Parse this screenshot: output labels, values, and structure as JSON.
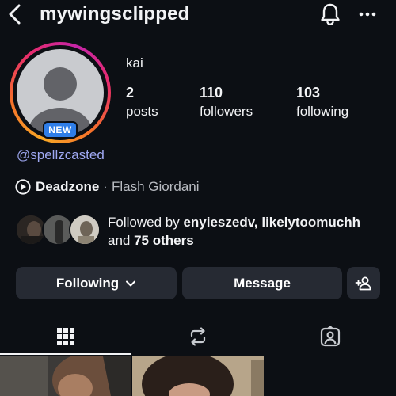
{
  "header": {
    "username": "mywingsclipped",
    "icons": {
      "back": "chevron-left-icon",
      "notifications": "bell-icon",
      "more": "more-horizontal-icon"
    }
  },
  "profile": {
    "display_name": "kai",
    "new_badge": "NEW",
    "handle": "@spellzcasted",
    "stats": [
      {
        "value": "2",
        "label": "posts"
      },
      {
        "value": "110",
        "label": "followers"
      },
      {
        "value": "103",
        "label": "following"
      }
    ]
  },
  "music": {
    "song": "Deadzone",
    "separator": "·",
    "artist": "Flash Giordani"
  },
  "followed_by": {
    "prefix": "Followed by ",
    "names": "enyieszedv, likelytoomuchh",
    "and_word": "and ",
    "others": "75 others"
  },
  "actions": {
    "following_label": "Following",
    "message_label": "Message"
  },
  "tabs": [
    "grid-icon",
    "reposts-icon",
    "tagged-icon"
  ],
  "colors": {
    "background": "#0c0f14",
    "button": "#262a33",
    "handle_link": "#9fa8f2",
    "new_badge": "#2f7ee8"
  }
}
